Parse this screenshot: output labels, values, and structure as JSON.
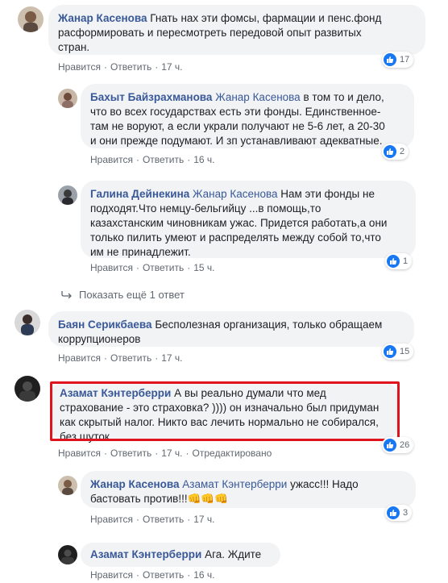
{
  "comments": [
    {
      "author": "Жанар Касенова",
      "lines": [
        "Гнать нах эти фомсы, фармации и пенс.фонд",
        "расформировать и пересмотреть передовой опыт развитых",
        "стран."
      ],
      "actions": {
        "like": "Нравится",
        "reply": "Ответить",
        "time": "17 ч."
      },
      "reactions": "17"
    },
    {
      "author": "Бахыт Байзрахманова",
      "mention": "Жанар Касенова",
      "lines": [
        "в том то и дело,",
        "что во всех государствах есть эти фонды. Единственное-",
        "там не воруют, а если украли получают не 5-6 лет, а 20-30",
        "и они прежде подумают. И зп устанавливают адекватные."
      ],
      "actions": {
        "like": "Нравится",
        "reply": "Ответить",
        "time": "16 ч."
      },
      "reactions": "2"
    },
    {
      "author": "Галина Дейнекина",
      "mention": "Жанар Касенова",
      "lines": [
        "Нам эти фонды не",
        "подходят.Что немцу-бельгийцу ...в помощь,то",
        "казахстанским чиновникам ужас. Придется работать,а они",
        "только пилить умеют и распределять между собой то,что",
        "им не принадлежит."
      ],
      "actions": {
        "like": "Нравится",
        "reply": "Ответить",
        "time": "15 ч."
      },
      "reactions": "1"
    },
    {
      "author": "Баян Серикбаева",
      "lines": [
        "Бесполезная организация, только обращаем",
        "коррупционеров"
      ],
      "actions": {
        "like": "Нравится",
        "reply": "Ответить",
        "time": "17 ч."
      },
      "reactions": "15"
    },
    {
      "author": "Азамат Кэнтерберри",
      "lines": [
        "А вы реально думали что мед",
        "страхование - это страховка? )))) он изначально был придуман",
        "как скрытый налог. Никто вас лечить нормально не собирался,",
        "без шуток"
      ],
      "actions": {
        "like": "Нравится",
        "reply": "Ответить",
        "time": "17 ч.",
        "edited": "Отредактировано"
      },
      "reactions": "26"
    },
    {
      "author": "Жанар Касенова",
      "mention": "Азамат Кэнтерберри",
      "lines": [
        "ужасс!!! Надо",
        "бастовать против!!!👊👊👊"
      ],
      "actions": {
        "like": "Нравится",
        "reply": "Ответить",
        "time": "17 ч."
      },
      "reactions": "3"
    },
    {
      "author": "Азамат Кэнтерберри",
      "lines": [
        "Ага. Ждите"
      ],
      "actions": {
        "like": "Нравится",
        "reply": "Ответить",
        "time": "16 ч."
      }
    }
  ],
  "show_more": "Показать ещё 1 ответ",
  "colors": {
    "link": "#385898",
    "bubble": "#f2f3f5",
    "meta": "#606770",
    "like": "#1877f2",
    "highlight": "#e0141e"
  }
}
